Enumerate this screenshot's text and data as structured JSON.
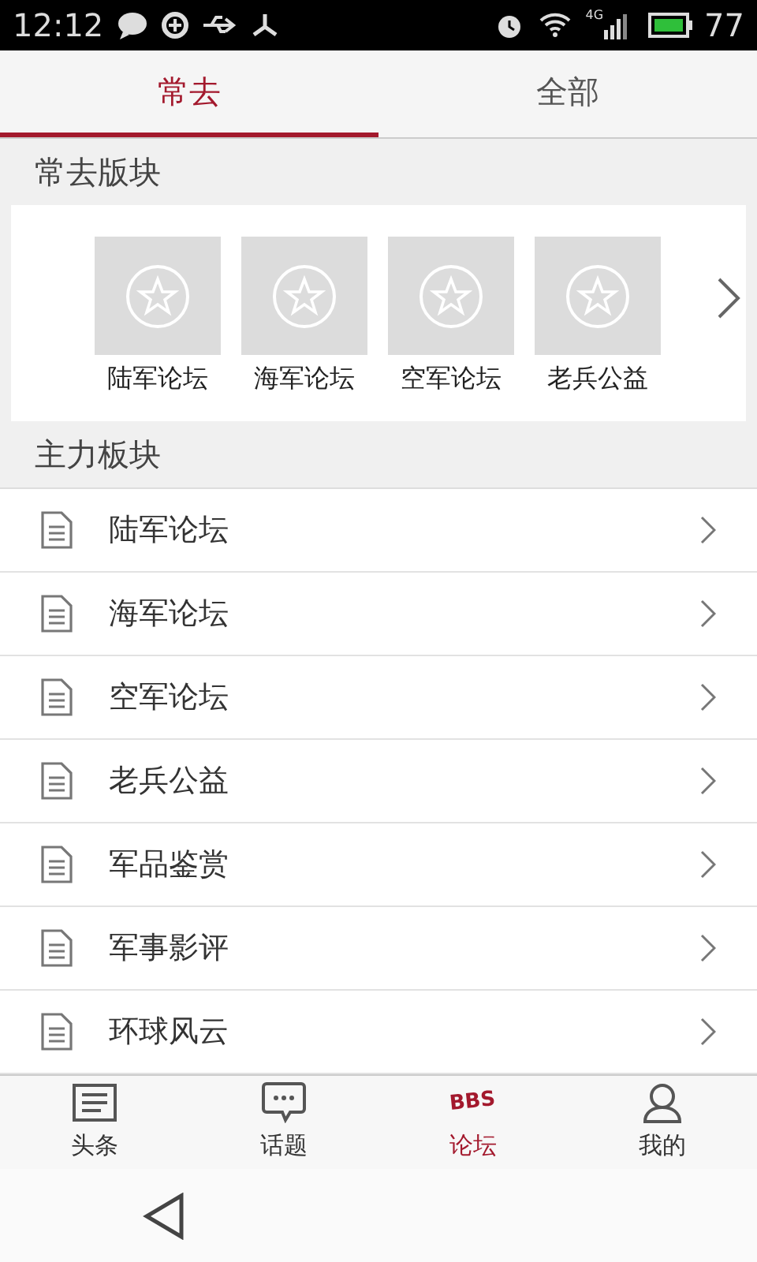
{
  "status_bar": {
    "time": "12:12",
    "network": "4G",
    "battery": "77"
  },
  "tabs": [
    {
      "label": "常去",
      "selected": true
    },
    {
      "label": "全部",
      "selected": false
    }
  ],
  "frequent": {
    "title": "常去版块",
    "items": [
      {
        "label": "陆军论坛"
      },
      {
        "label": "海军论坛"
      },
      {
        "label": "空军论坛"
      },
      {
        "label": "老兵公益"
      }
    ]
  },
  "main": {
    "title": "主力板块",
    "items": [
      {
        "label": "陆军论坛"
      },
      {
        "label": "海军论坛"
      },
      {
        "label": "空军论坛"
      },
      {
        "label": "老兵公益"
      },
      {
        "label": "军品鉴赏"
      },
      {
        "label": "军事影评"
      },
      {
        "label": "环球风云"
      }
    ]
  },
  "bottom_nav": [
    {
      "kind": "news",
      "label": "头条",
      "selected": false
    },
    {
      "kind": "chat",
      "label": "话题",
      "selected": false
    },
    {
      "kind": "bbs",
      "label": "论坛",
      "icon_text": "BBS",
      "selected": true
    },
    {
      "kind": "profile",
      "label": "我的",
      "selected": false
    }
  ]
}
